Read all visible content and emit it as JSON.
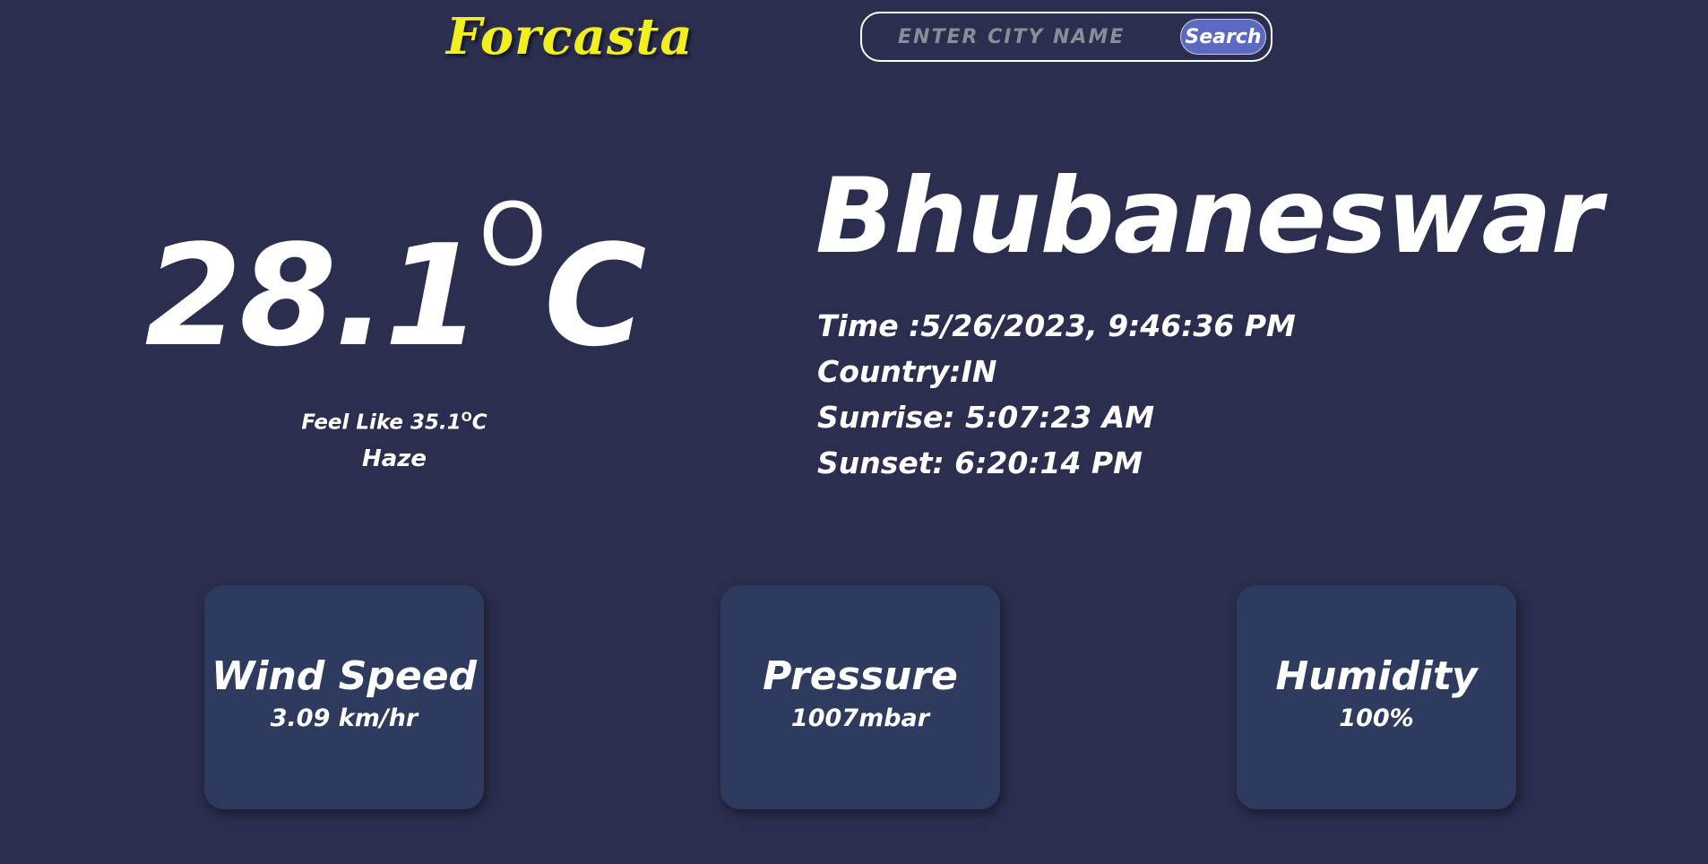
{
  "header": {
    "logo": "Forcasta",
    "search": {
      "placeholder": "ENTER CITY NAME",
      "value": "",
      "button_label": "Search"
    }
  },
  "weather": {
    "temperature": "28.1",
    "temperature_unit": "C",
    "degree_symbol": "O",
    "feels_like_label": "Feel Like",
    "feels_like_value": "35.1",
    "feels_like_unit": "C",
    "condition": "Haze"
  },
  "location": {
    "city": "Bhubaneswar",
    "time": "Time :5/26/2023, 9:46:36 PM",
    "country": "Country:IN",
    "sunrise": "Sunrise: 5:07:23 AM",
    "sunset": "Sunset: 6:20:14 PM"
  },
  "cards": [
    {
      "title": "Wind Speed",
      "value": "3.09 km/hr"
    },
    {
      "title": "Pressure",
      "value": "1007mbar"
    },
    {
      "title": "Humidity",
      "value": "100%"
    }
  ],
  "colors": {
    "background": "#2b2e4e",
    "logo": "#f1ef1e",
    "card": "#2e3a5e",
    "button": "#5b6ac0",
    "text": "#ffffff"
  }
}
